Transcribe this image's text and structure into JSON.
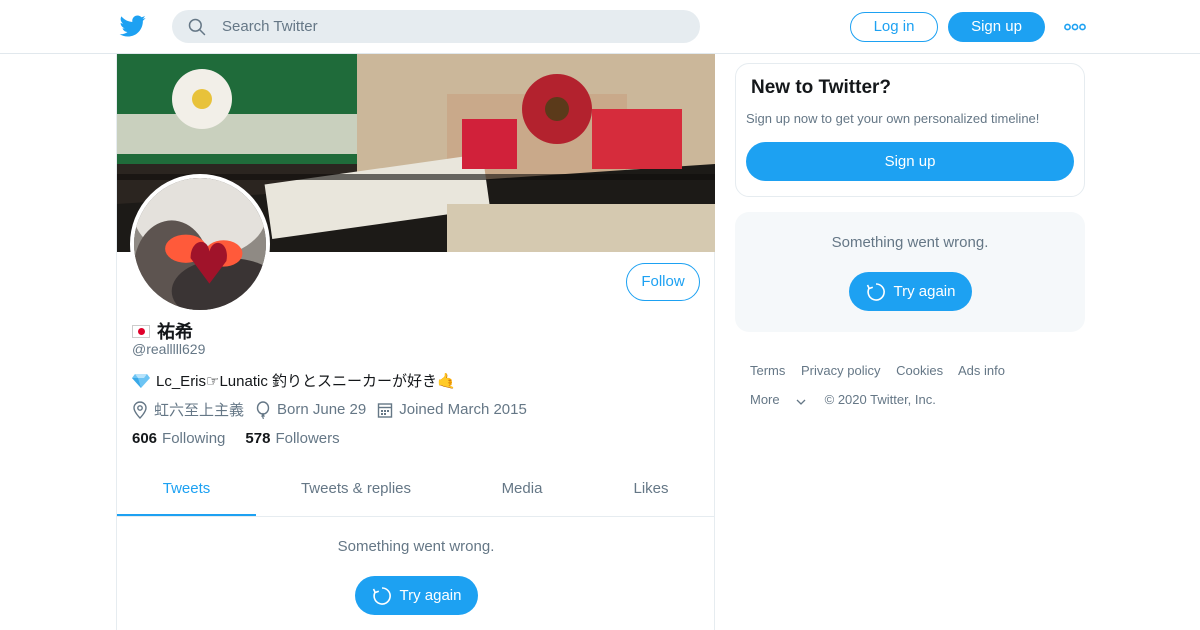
{
  "header": {
    "search_placeholder": "Search Twitter",
    "login_label": "Log in",
    "signup_label": "Sign up",
    "more_icon": "more-dots-icon",
    "logo_icon": "twitter-bird-icon"
  },
  "profile": {
    "flag_icon": "japan-flag-icon",
    "name": "祐希",
    "handle": "@realllll629",
    "bio": "Lc_Eris☞Lunatic 釣りとスニーカーが好き🤙",
    "location": "虹六至上主義",
    "birthday": "Born June 29",
    "joined": "Joined March 2015",
    "following_count": "606",
    "following_label": "Following",
    "followers_count": "578",
    "followers_label": "Followers",
    "follow_label": "Follow"
  },
  "tabs": [
    {
      "label": "Tweets",
      "active": true
    },
    {
      "label": "Tweets & replies",
      "active": false
    },
    {
      "label": "Media",
      "active": false
    },
    {
      "label": "Likes",
      "active": false
    }
  ],
  "timeline": {
    "error_message": "Something went wrong.",
    "retry_label": "Try again"
  },
  "sidebar": {
    "new_title": "New to Twitter?",
    "new_subtitle": "Sign up now to get your own personalized timeline!",
    "signup_label": "Sign up",
    "error_message": "Something went wrong.",
    "retry_label": "Try again"
  },
  "footer": {
    "links": [
      "Terms",
      "Privacy policy",
      "Cookies",
      "Ads info"
    ],
    "more_label": "More",
    "copyright": "© 2020 Twitter, Inc."
  },
  "colors": {
    "accent": "#1da1f2",
    "secondary_text": "#657786",
    "primary_text": "#14171a"
  }
}
